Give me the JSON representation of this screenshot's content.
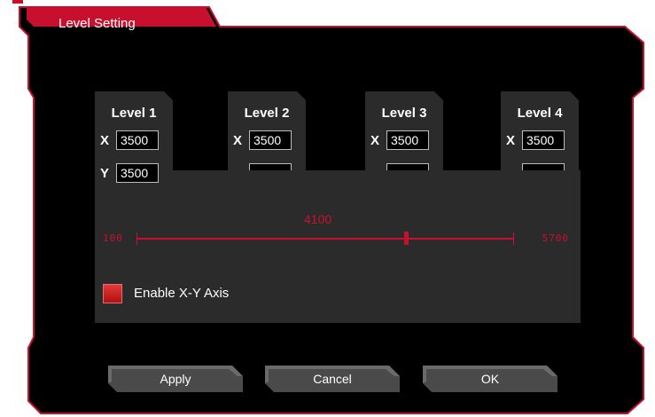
{
  "window": {
    "title": "Level Setting"
  },
  "levels": [
    {
      "title": "Level 1",
      "x_label": "X",
      "x_value": "3500",
      "y_label": "Y",
      "y_value": "3500"
    },
    {
      "title": "Level 2",
      "x_label": "X",
      "x_value": "3500"
    },
    {
      "title": "Level 3",
      "x_label": "X",
      "x_value": "3500"
    },
    {
      "title": "Level 4",
      "x_label": "X",
      "x_value": "3500"
    }
  ],
  "slider": {
    "min_label": "100",
    "max_label": "5700",
    "value_label": "4100",
    "min": 100,
    "max": 5700,
    "value": 4100
  },
  "options": {
    "enable_xy_axis_label": "Enable X-Y Axis",
    "enable_xy_axis_checked": true
  },
  "buttons": {
    "apply": "Apply",
    "cancel": "Cancel",
    "ok": "OK"
  },
  "colors": {
    "accent": "#c8102e",
    "background": "#000000",
    "panel": "#2b2b2b"
  }
}
